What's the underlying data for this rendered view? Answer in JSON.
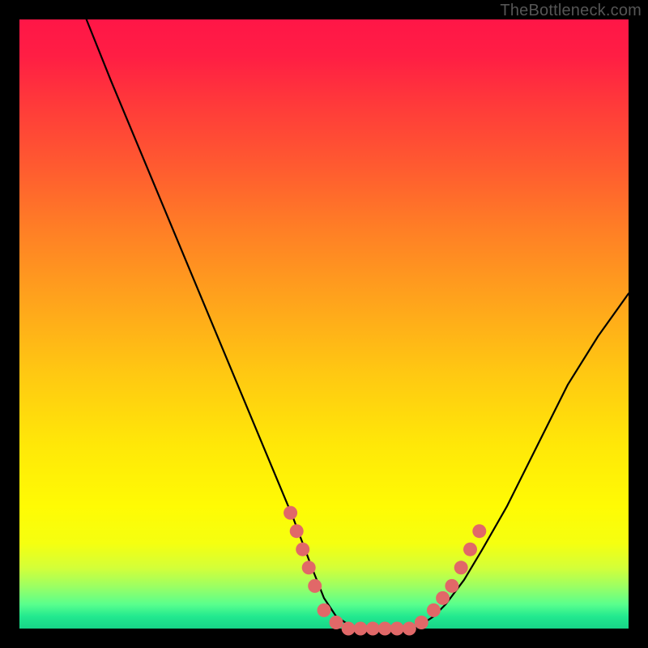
{
  "watermark": "TheBottleneck.com",
  "chart_data": {
    "type": "line",
    "title": "",
    "xlabel": "",
    "ylabel": "",
    "xlim": [
      0,
      100
    ],
    "ylim": [
      0,
      100
    ],
    "grid": false,
    "series": [
      {
        "name": "bottleneck-curve",
        "color": "#000000",
        "x": [
          11,
          15,
          20,
          25,
          30,
          35,
          40,
          45,
          48,
          50,
          52,
          55,
          58,
          60,
          62,
          65,
          68,
          70,
          73,
          76,
          80,
          85,
          90,
          95,
          100
        ],
        "y": [
          100,
          90,
          78,
          66,
          54,
          42,
          30,
          18,
          10,
          5,
          2,
          0,
          0,
          0,
          0,
          0,
          2,
          4,
          8,
          13,
          20,
          30,
          40,
          48,
          55
        ]
      }
    ],
    "markers": {
      "name": "highlight-dots",
      "color": "#e16868",
      "x": [
        44.5,
        45.5,
        46.5,
        47.5,
        48.5,
        50,
        52,
        54,
        56,
        58,
        60,
        62,
        64,
        66,
        68,
        69.5,
        71,
        72.5,
        74,
        75.5
      ],
      "y": [
        19,
        16,
        13,
        10,
        7,
        3,
        1,
        0,
        0,
        0,
        0,
        0,
        0,
        1,
        3,
        5,
        7,
        10,
        13,
        16
      ]
    }
  }
}
